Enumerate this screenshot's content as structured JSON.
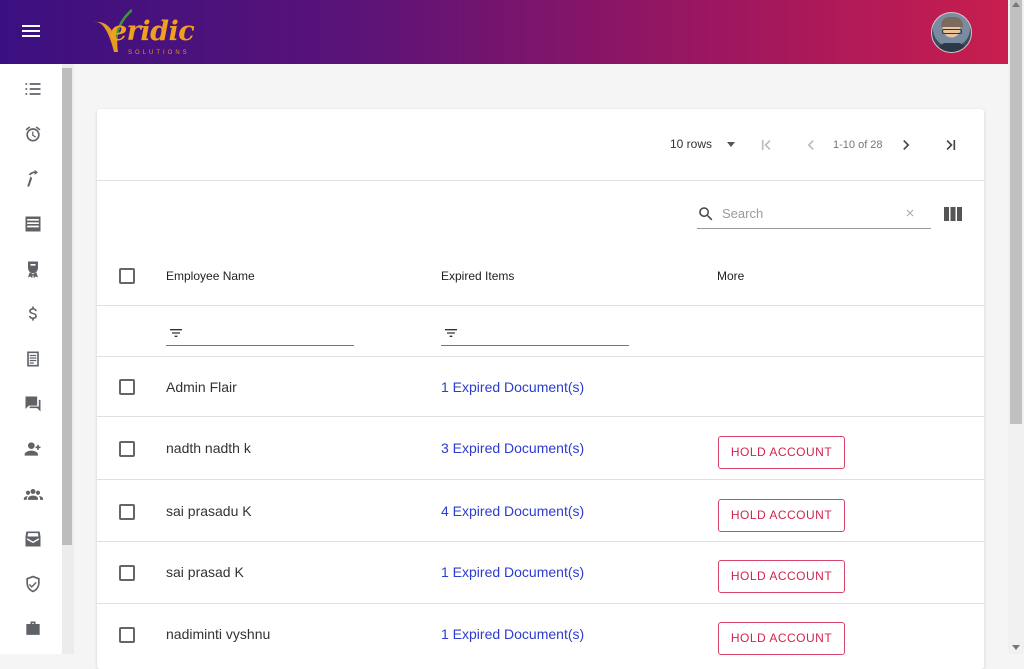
{
  "app": {
    "logo_text": "eridic",
    "logo_sub": "SOLUTIONS"
  },
  "colors": {
    "topbar_start": "#3a1080",
    "topbar_end": "#c81e4e",
    "link": "#2c3ccf",
    "hold_button": "#d0254f"
  },
  "sidebar": {
    "icons": [
      "checklist-icon",
      "alarm-icon",
      "tools-icon",
      "document-list-icon",
      "certificate-icon",
      "dollar-icon",
      "notes-icon",
      "chat-icon",
      "add-user-icon",
      "group-icon",
      "mail-box-icon",
      "shield-check-icon",
      "briefcase-icon"
    ]
  },
  "pager": {
    "rows_label": "10 rows",
    "range": "1-10 of 28"
  },
  "search": {
    "placeholder": "Search"
  },
  "table": {
    "headers": {
      "name": "Employee Name",
      "expired": "Expired Items",
      "more": "More"
    },
    "rows": [
      {
        "name": "Admin Flair",
        "expired": "1 Expired Document(s)",
        "action": ""
      },
      {
        "name": "nadth nadth k",
        "expired": "3 Expired Document(s)",
        "action": "HOLD ACCOUNT"
      },
      {
        "name": "sai prasadu K",
        "expired": "4 Expired Document(s)",
        "action": "HOLD ACCOUNT"
      },
      {
        "name": "sai prasad K",
        "expired": "1 Expired Document(s)",
        "action": "HOLD ACCOUNT"
      },
      {
        "name": "nadiminti vyshnu",
        "expired": "1 Expired Document(s)",
        "action": "HOLD ACCOUNT"
      }
    ]
  }
}
